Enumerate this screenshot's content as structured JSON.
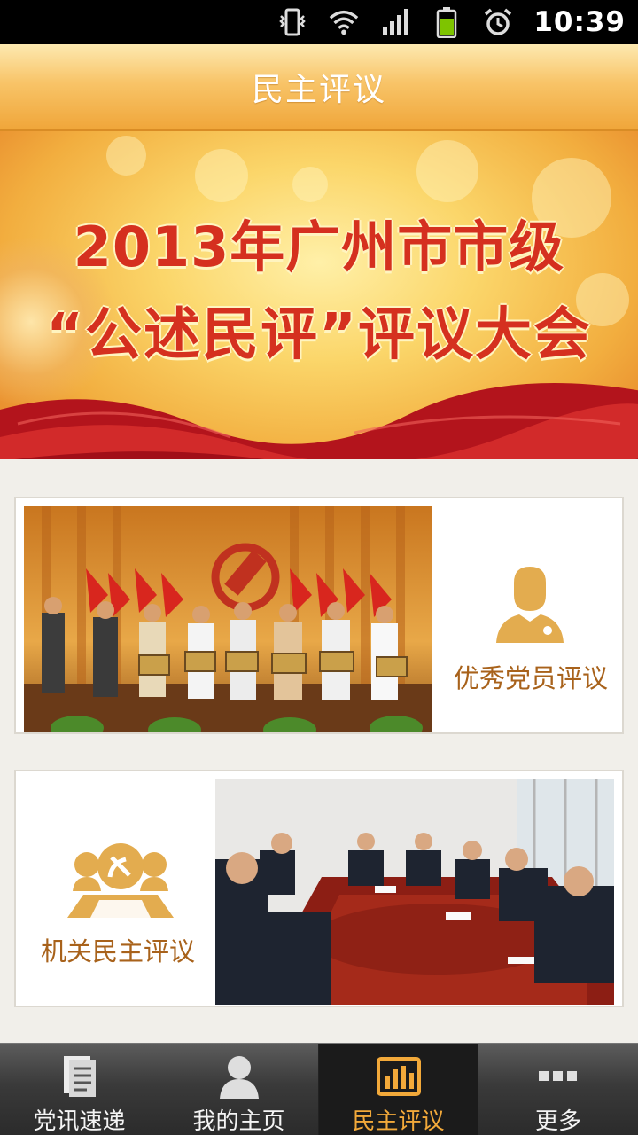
{
  "status_bar": {
    "time": "10:39",
    "icons": [
      "vibrate-icon",
      "wifi-icon",
      "signal-icon",
      "battery-icon",
      "alarm-icon"
    ]
  },
  "header": {
    "title": "民主评议"
  },
  "banner": {
    "line1": "2013年广州市市级",
    "line2": "“公述民评”评议大会"
  },
  "cards": [
    {
      "label": "优秀党员评议",
      "icon": "party-member-icon"
    },
    {
      "label": "机关民主评议",
      "icon": "party-organ-icon"
    }
  ],
  "bottom_nav": {
    "items": [
      {
        "label": "党讯速递",
        "icon": "news-icon",
        "active": false
      },
      {
        "label": "我的主页",
        "icon": "user-icon",
        "active": false
      },
      {
        "label": "民主评议",
        "icon": "bar-chart-icon",
        "active": true
      },
      {
        "label": "更多",
        "icon": "more-icon",
        "active": false
      }
    ]
  },
  "colors": {
    "accent": "#f2a93a",
    "card_label": "#a8621b",
    "banner_text": "#d5301f",
    "icon_gold": "#e3ac4f"
  }
}
